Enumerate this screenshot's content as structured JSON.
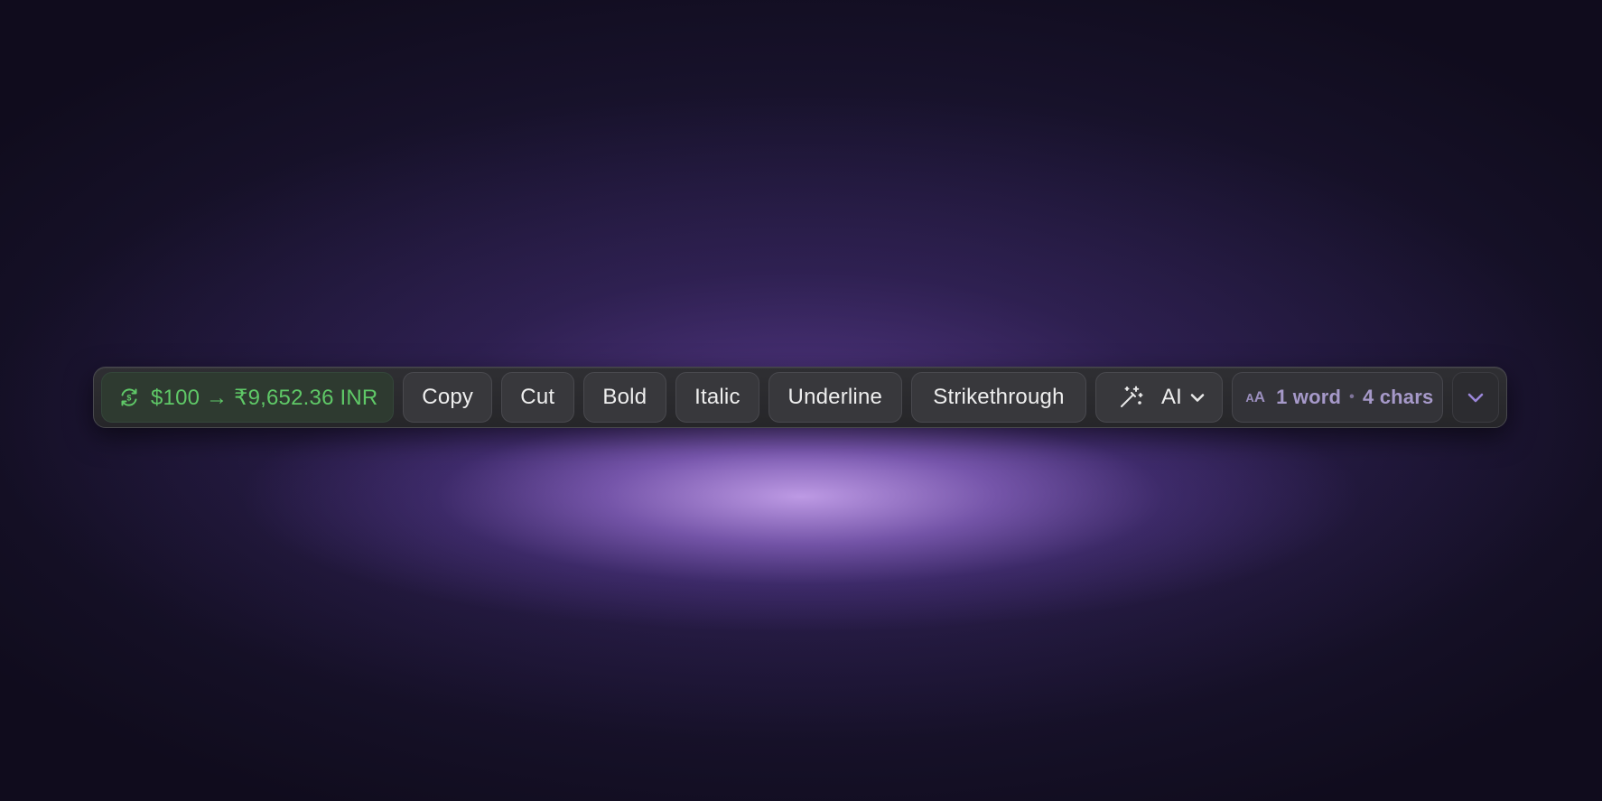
{
  "toolbar": {
    "currency": {
      "label": "$100 → ₹9,652.36 INR",
      "icon": "currency-exchange-icon",
      "color": "#5fc867"
    },
    "buttons": {
      "copy": "Copy",
      "cut": "Cut",
      "bold": "Bold",
      "italic": "Italic",
      "underline": "Underline",
      "strikethrough": "Strikethrough"
    },
    "ai": {
      "label": "AI",
      "icon": "magic-wand-icon",
      "dropdown_icon": "chevron-down-icon"
    },
    "stats": {
      "icon_text_small": "A",
      "icon_text_large": "A",
      "words": "1 word",
      "separator": "•",
      "chars": "4 chars",
      "color": "#a699c9"
    },
    "expand_icon": "chevron-down-icon",
    "accent_color": "#9a86d8"
  }
}
